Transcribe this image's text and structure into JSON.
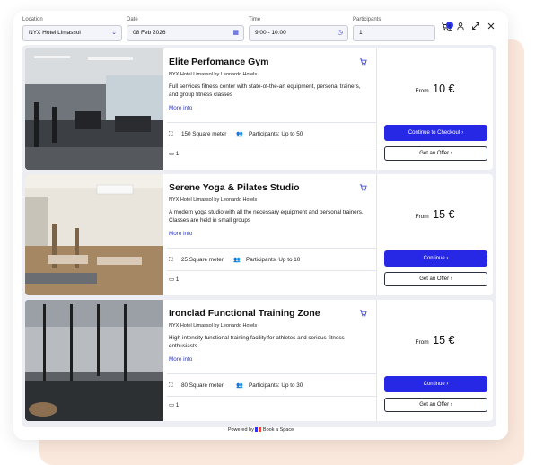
{
  "filters": {
    "location": {
      "label": "Location",
      "value": "NYX Hotel Limassol",
      "icon": "chevron-down-icon"
    },
    "date": {
      "label": "Date",
      "value": "08 Feb 2026",
      "icon": "calendar-icon"
    },
    "time": {
      "label": "Time",
      "value": "9:00 - 10:00",
      "icon": "clock-icon"
    },
    "participants": {
      "label": "Participants",
      "value": "1"
    }
  },
  "toolbar": {
    "cart_count": "1",
    "icons": [
      "cart-icon",
      "user-icon",
      "expand-icon",
      "close-icon"
    ]
  },
  "spaces": [
    {
      "name": "Elite Perfomance Gym",
      "hotel": "NYX Hotel Limassol by Leonardo Hotels",
      "description": "Full services fitness center with state-of-the-art equipment, personal trainers, and group fitness classes",
      "more_info": "More info",
      "size": "150 Square meter",
      "participants": "Participants: Up to 50",
      "rooms": "1",
      "price_prefix": "From",
      "price": "10 €",
      "primary_label": "Continue to Checkout",
      "secondary_label": "Get an Offer"
    },
    {
      "name": "Serene Yoga & Pilates Studio",
      "hotel": "NYX Hotel Limassol by Leonardo Hotels",
      "description": "A modern yoga studio with all the necessary equipment and personal trainers. Classes are held in small groups",
      "more_info": "More info",
      "size": "25 Square meter",
      "participants": "Participants: Up to 10",
      "rooms": "1",
      "price_prefix": "From",
      "price": "15 €",
      "primary_label": "Continue",
      "secondary_label": "Get an Offer"
    },
    {
      "name": "Ironclad Functional Training Zone",
      "hotel": "NYX Hotel Limassol by Leonardo Hotels",
      "description": "High-intensity functional training facility for athletes and serious fitness enthusiasts",
      "more_info": "More info",
      "size": "80 Square meter",
      "participants": "Participants: Up to 30",
      "rooms": "1",
      "price_prefix": "From",
      "price": "15 €",
      "primary_label": "Continue",
      "secondary_label": "Get an Offer"
    }
  ],
  "footer": {
    "powered_by": "Powered by",
    "brand": "Book a Space"
  }
}
